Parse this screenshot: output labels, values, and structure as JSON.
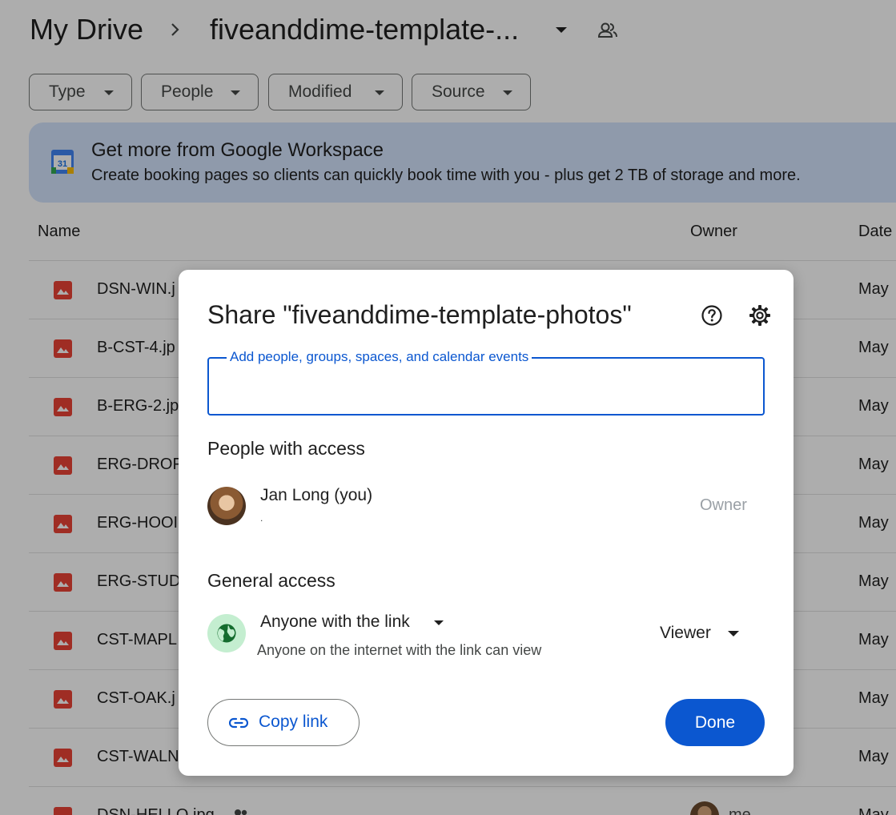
{
  "breadcrumb": {
    "root": "My Drive",
    "folder": "fiveanddime-template-..."
  },
  "filters": [
    "Type",
    "People",
    "Modified",
    "Source"
  ],
  "banner": {
    "title": "Get more from Google Workspace",
    "subtitle": "Create booking pages so clients can quickly book time with you - plus get 2 TB of storage and more.",
    "calendar_day": "31"
  },
  "table": {
    "headers": {
      "name": "Name",
      "owner": "Owner",
      "date": "Date"
    },
    "rows": [
      {
        "name": "DSN-WIN.j",
        "date": "May"
      },
      {
        "name": "B-CST-4.jp",
        "date": "May"
      },
      {
        "name": "B-ERG-2.jp",
        "date": "May"
      },
      {
        "name": "ERG-DROF",
        "date": "May"
      },
      {
        "name": "ERG-HOOI",
        "date": "May"
      },
      {
        "name": "ERG-STUD",
        "date": "May"
      },
      {
        "name": "CST-MAPL",
        "date": "May"
      },
      {
        "name": "CST-OAK.j",
        "date": "May"
      },
      {
        "name": "CST-WALN",
        "date": "May"
      },
      {
        "name": "DSN-HELLO.jpg",
        "date": "May",
        "owner": "me"
      }
    ]
  },
  "dialog": {
    "title": "Share \"fiveanddime-template-photos\"",
    "add_label": "Add people, groups, spaces, and calendar events",
    "add_value": "",
    "people_heading": "People with access",
    "person": {
      "name": "Jan Long (you)",
      "email": ".",
      "role": "Owner"
    },
    "general_heading": "General access",
    "access_level": "Anyone with the link",
    "access_desc": "Anyone on the internet with the link can view",
    "role": "Viewer",
    "copy_link": "Copy link",
    "done": "Done"
  },
  "colors": {
    "accent": "#0b57d0",
    "banner": "#d3e3fd",
    "file_icon": "#ea4335",
    "globe_bg": "#c4eed0"
  }
}
